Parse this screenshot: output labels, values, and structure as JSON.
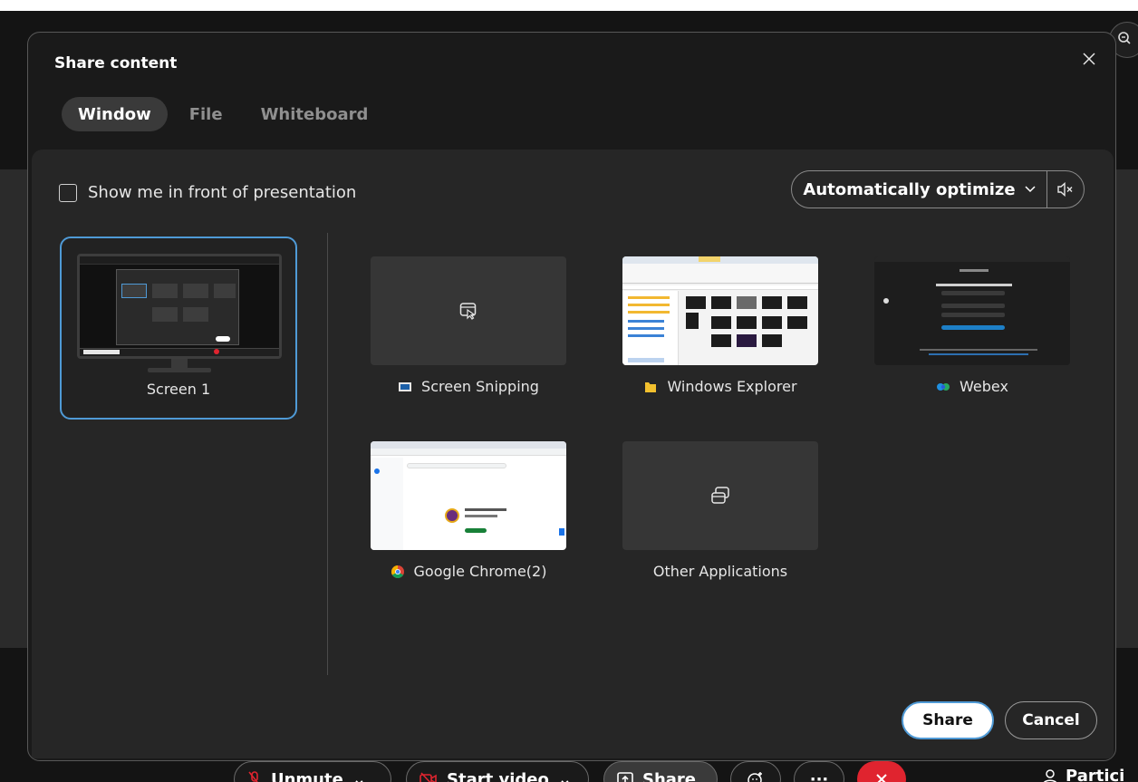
{
  "dialog": {
    "title": "Share content",
    "close_label": "×"
  },
  "tabs": [
    {
      "label": "Window",
      "active": true
    },
    {
      "label": "File",
      "active": false
    },
    {
      "label": "Whiteboard",
      "active": false
    }
  ],
  "options": {
    "show_me_label": "Show me in front of presentation",
    "show_me_checked": false,
    "optimize_label": "Automatically optimize",
    "audio_icon": "speaker-muted-icon"
  },
  "screens": [
    {
      "label": "Screen 1",
      "selected": true
    }
  ],
  "windows": [
    {
      "label": "Screen Snipping",
      "icon": "snipping-icon"
    },
    {
      "label": "Windows Explorer",
      "icon": "folder-icon"
    },
    {
      "label": "Webex",
      "icon": "webex-icon"
    },
    {
      "label": "Google Chrome(2)",
      "icon": "chrome-icon"
    },
    {
      "label": "Other Applications",
      "icon": "windows-stack-icon"
    }
  ],
  "actions": {
    "share_label": "Share",
    "cancel_label": "Cancel"
  },
  "toolbar": {
    "unmute_label": "Unmute",
    "video_label": "Start video",
    "share_label": "Share",
    "more_label": "···",
    "participants_label": "Partici"
  },
  "colors": {
    "accent": "#4f9ad6",
    "dialog_bg": "#1a1a1a",
    "panel_bg": "#262626",
    "leave": "#e0242f"
  }
}
